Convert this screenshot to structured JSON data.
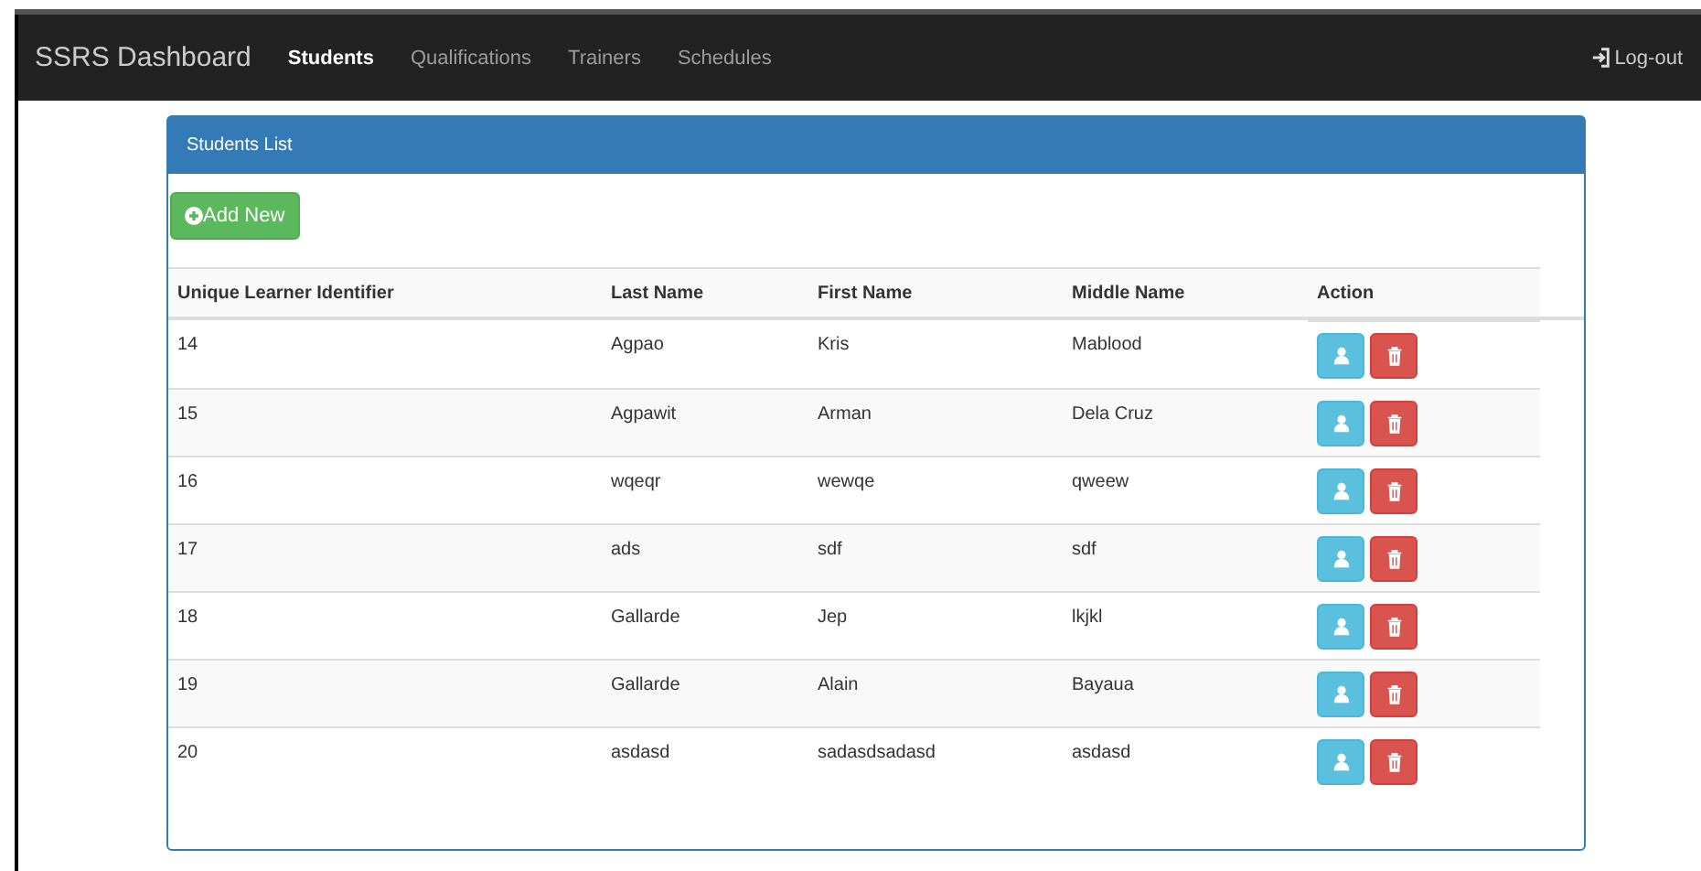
{
  "navbar": {
    "brand": "SSRS Dashboard",
    "links": [
      {
        "label": "Students",
        "selected": true
      },
      {
        "label": "Qualifications",
        "selected": false
      },
      {
        "label": "Trainers",
        "selected": false
      },
      {
        "label": "Schedules",
        "selected": false
      }
    ],
    "logout": "Log-out"
  },
  "panel": {
    "title": "Students List",
    "add_button": "Add New"
  },
  "table": {
    "columns": [
      "Unique Learner Identifier",
      "Last Name",
      "First Name",
      "Middle Name",
      "Action"
    ],
    "rows": [
      {
        "id": "14",
        "last": "Agpao",
        "first": "Kris",
        "middle": "Mablood"
      },
      {
        "id": "15",
        "last": "Agpawit",
        "first": "Arman",
        "middle": "Dela Cruz"
      },
      {
        "id": "16",
        "last": "wqeqr",
        "first": "wewqe",
        "middle": "qweew"
      },
      {
        "id": "17",
        "last": "ads",
        "first": "sdf",
        "middle": "sdf"
      },
      {
        "id": "18",
        "last": "Gallarde",
        "first": "Jep",
        "middle": "lkjkl"
      },
      {
        "id": "19",
        "last": "Gallarde",
        "first": "Alain",
        "middle": "Bayaua"
      },
      {
        "id": "20",
        "last": "asdasd",
        "first": "sadasdsadasd",
        "middle": "asdasd"
      }
    ]
  }
}
